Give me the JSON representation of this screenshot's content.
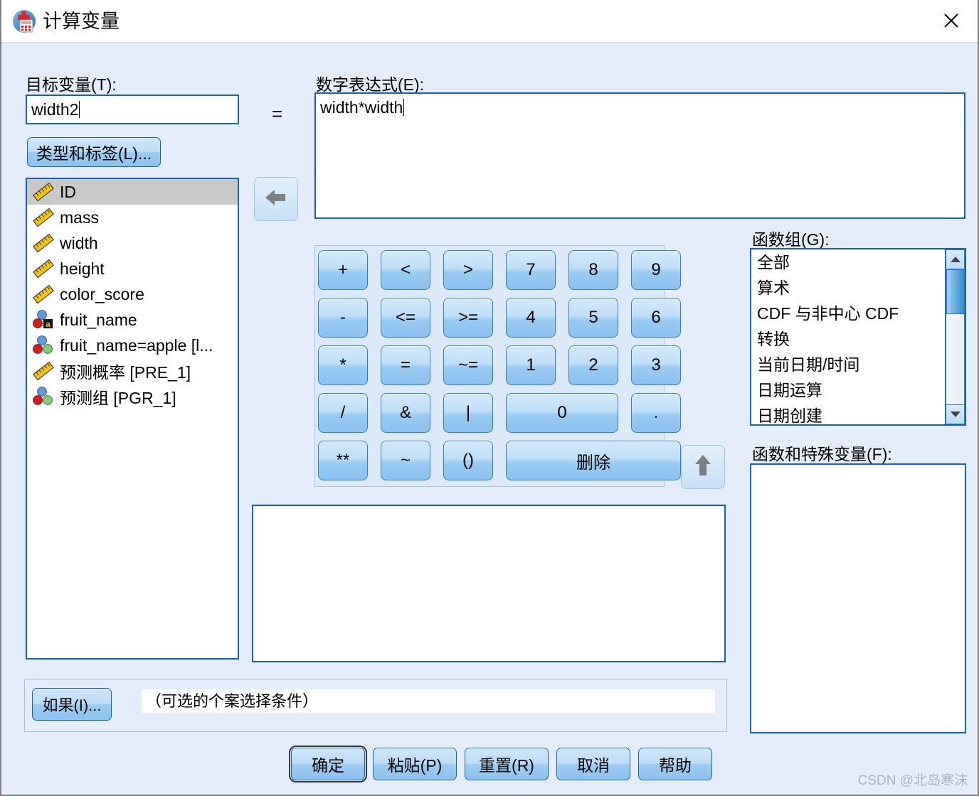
{
  "window": {
    "title": "计算变量",
    "icon": "compute-variable-icon",
    "close_label": "×"
  },
  "target": {
    "label": "目标变量(T):",
    "label_plain": "目标变量",
    "accelerator": "T",
    "value": "width2",
    "type_label_button": "类型和标签(L)...",
    "equals": "="
  },
  "expression": {
    "label": "数字表达式(E):",
    "accelerator": "E",
    "value": "width*width"
  },
  "variables": {
    "items": [
      {
        "name": "ID",
        "icon": "scale-ruler-icon",
        "selected": true
      },
      {
        "name": "mass",
        "icon": "scale-ruler-icon",
        "selected": false
      },
      {
        "name": "width",
        "icon": "scale-ruler-icon",
        "selected": false
      },
      {
        "name": "height",
        "icon": "scale-ruler-icon",
        "selected": false
      },
      {
        "name": "color_score",
        "icon": "scale-ruler-icon",
        "selected": false
      },
      {
        "name": "fruit_name",
        "icon": "nominal-string-icon",
        "selected": false
      },
      {
        "name": "fruit_name=apple [l...",
        "icon": "nominal-icon",
        "selected": false
      },
      {
        "name": "预测概率 [PRE_1]",
        "icon": "scale-ruler-icon",
        "selected": false
      },
      {
        "name": "预测组 [PGR_1]",
        "icon": "nominal-icon",
        "selected": false
      }
    ]
  },
  "move_to_expression_button": {
    "icon": "arrow-left-icon",
    "enabled": false
  },
  "move_to_function_button": {
    "icon": "arrow-up-icon",
    "enabled": false
  },
  "keypad": {
    "keys": [
      {
        "label": "+",
        "name": "key-plus"
      },
      {
        "label": "<",
        "name": "key-less-than"
      },
      {
        "label": ">",
        "name": "key-greater-than"
      },
      {
        "label": "7",
        "name": "key-7"
      },
      {
        "label": "8",
        "name": "key-8"
      },
      {
        "label": "9",
        "name": "key-9"
      },
      {
        "label": "-",
        "name": "key-minus"
      },
      {
        "label": "<=",
        "name": "key-less-equal"
      },
      {
        "label": ">=",
        "name": "key-greater-equal"
      },
      {
        "label": "4",
        "name": "key-4"
      },
      {
        "label": "5",
        "name": "key-5"
      },
      {
        "label": "6",
        "name": "key-6"
      },
      {
        "label": "*",
        "name": "key-multiply"
      },
      {
        "label": "=",
        "name": "key-equals"
      },
      {
        "label": "~=",
        "name": "key-not-equal"
      },
      {
        "label": "1",
        "name": "key-1"
      },
      {
        "label": "2",
        "name": "key-2"
      },
      {
        "label": "3",
        "name": "key-3"
      },
      {
        "label": "/",
        "name": "key-divide"
      },
      {
        "label": "&",
        "name": "key-and"
      },
      {
        "label": "|",
        "name": "key-or"
      },
      {
        "label": "0",
        "name": "key-0"
      },
      {
        "label": ".",
        "name": "key-decimal"
      },
      {
        "label": "**",
        "name": "key-power"
      },
      {
        "label": "~",
        "name": "key-not"
      },
      {
        "label": "()",
        "name": "key-parentheses"
      },
      {
        "label": "删除",
        "name": "key-delete"
      }
    ]
  },
  "function_group": {
    "label": "函数组(G):",
    "accelerator": "G",
    "items": [
      "全部",
      "算术",
      "CDF 与非中心 CDF",
      "转换",
      "当前日期/时间",
      "日期运算",
      "日期创建"
    ],
    "scroll": {
      "thumb_top_percent": 0,
      "thumb_size_percent": 33
    }
  },
  "functions_and_special_variables": {
    "label": "函数和特殊变量(F):",
    "accelerator": "F",
    "items": []
  },
  "function_description": {
    "text": ""
  },
  "if_section": {
    "button_label": "如果(I)...",
    "accelerator": "I",
    "condition_text": "（可选的个案选择条件）"
  },
  "footer": {
    "buttons": [
      {
        "label": "确定",
        "name": "ok-button",
        "focused": true
      },
      {
        "label": "粘贴(P)",
        "name": "paste-button",
        "focused": false
      },
      {
        "label": "重置(R)",
        "name": "reset-button",
        "focused": false
      },
      {
        "label": "取消",
        "name": "cancel-button",
        "focused": false
      },
      {
        "label": "帮助",
        "name": "help-button",
        "focused": false
      }
    ]
  },
  "watermark": "CSDN @北岛寒沫",
  "colors": {
    "dialog_background": "#e4edf9",
    "border_blue": "#1464b4",
    "button_blue": "#9ccbf2",
    "selected_row": "#c9c9c9",
    "title_bar": "#ffffff",
    "scale_icon_yellow": "#f2c40f",
    "nominal_red": "#cc2222",
    "nominal_blue": "#6699dd",
    "nominal_green": "#88cc77"
  }
}
